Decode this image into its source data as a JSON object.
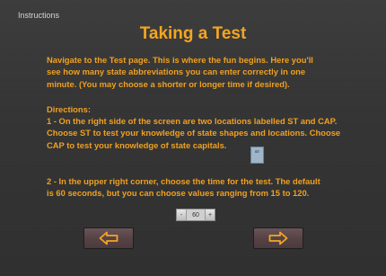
{
  "header": {
    "nav_title": "Instructions",
    "title": "Taking a Test"
  },
  "content": {
    "intro": "Navigate to the Test page. This is where the fun begins. Here you'll\nsee how many state abbreviations you can enter correctly in one\nminute. (You may choose a shorter or longer time if desired).",
    "directions_heading": "Directions:",
    "step1": "1 - On the right side of the screen are two locations labelled ST and CAP.\nChoose ST to test your knowledge of state shapes and locations. Choose\nCAP to test your knowledge of state capitals.",
    "st_badge_label": "ST",
    "step2": "2 - In the upper right corner, choose the time for the test. The default\nis 60 seconds, but you can choose values ranging from 15 to 120."
  },
  "stepper": {
    "minus": "-",
    "value": "60",
    "plus": "+"
  },
  "navigation": {
    "prev_icon": "arrow-left-icon",
    "next_icon": "arrow-right-icon"
  },
  "colors": {
    "accent": "#f3a621",
    "background": "#343434"
  }
}
